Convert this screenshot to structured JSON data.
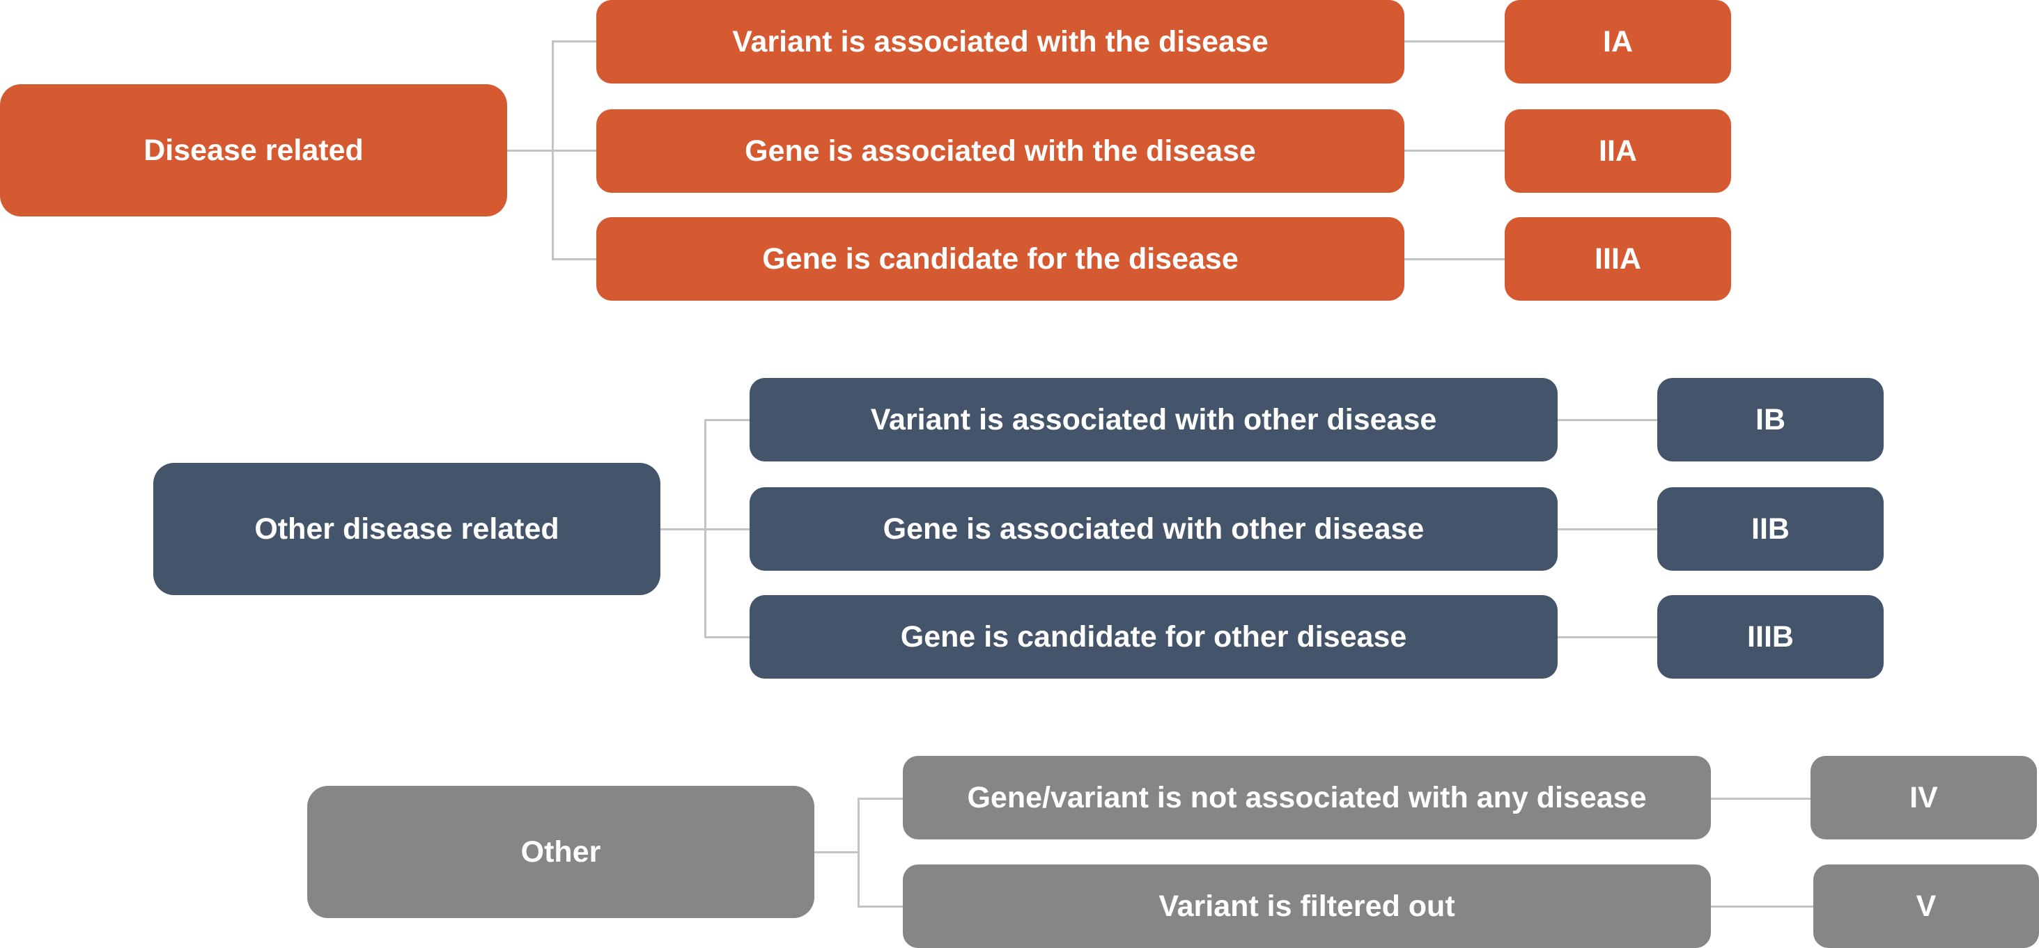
{
  "colors": {
    "disease_related": "#D55A31",
    "other_disease_related": "#44546A",
    "other": "#868686",
    "connector": "#C3C3C3"
  },
  "groups": [
    {
      "label": "Disease related",
      "items": [
        {
          "text": "Variant is associated with the disease",
          "code": "IA"
        },
        {
          "text": "Gene is associated with the disease",
          "code": "IIA"
        },
        {
          "text": "Gene is candidate for the disease",
          "code": "IIIA"
        }
      ]
    },
    {
      "label": "Other disease related",
      "items": [
        {
          "text": "Variant is associated with other disease",
          "code": "IB"
        },
        {
          "text": "Gene is associated with other disease",
          "code": "IIB"
        },
        {
          "text": "Gene is candidate for other disease",
          "code": "IIIB"
        }
      ]
    },
    {
      "label": "Other",
      "items": [
        {
          "text": "Gene/variant is not associated with any disease",
          "code": "IV"
        },
        {
          "text": "Variant is filtered out",
          "code": "V"
        }
      ]
    }
  ]
}
